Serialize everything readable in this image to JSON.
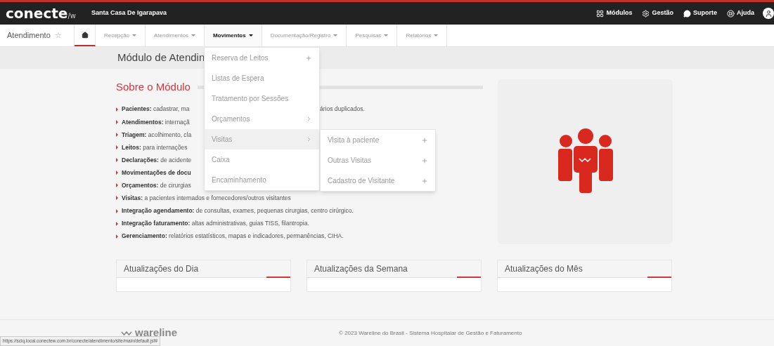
{
  "topbar": {
    "logo": "conecte",
    "logo_suffix": "/w",
    "site": "Santa Casa De Igarapava",
    "links": [
      {
        "kind": "grid",
        "label": "Módulos"
      },
      {
        "kind": "gear",
        "label": "Gestão"
      },
      {
        "kind": "chat",
        "label": "Suporte"
      },
      {
        "kind": "help",
        "label": "Ajuda"
      }
    ]
  },
  "nav": {
    "module": "Atendimento",
    "star": "☆",
    "tabs": [
      {
        "kind": "home",
        "selected": true
      },
      {
        "kind": "menu",
        "label": "Recepção",
        "selected": false,
        "open": false
      },
      {
        "kind": "menu",
        "label": "Atendimentos",
        "selected": false,
        "open": false
      },
      {
        "kind": "menu",
        "label": "Movimentos",
        "selected": false,
        "open": true
      },
      {
        "kind": "menu",
        "label": "Documentação/Registro",
        "selected": false,
        "open": false
      },
      {
        "kind": "menu",
        "label": "Pesquisas",
        "selected": false,
        "open": false
      },
      {
        "kind": "menu",
        "label": "Relatórios",
        "selected": false,
        "open": false
      }
    ]
  },
  "page_title": "Módulo de Atendin",
  "about": {
    "title": "Sobre o Módulo",
    "items": [
      {
        "label": "Pacientes:",
        "text": " cadastrar, ma",
        "tail": "ários duplicados."
      },
      {
        "label": "Atendimentos:",
        "text": " internaçã"
      },
      {
        "label": "Triagem:",
        "text": " acolhimento, cla"
      },
      {
        "label": "Leitos:",
        "text": " para internações "
      },
      {
        "label": "Declarações:",
        "text": " de acidente"
      },
      {
        "label": "Movimentações de docu"
      },
      {
        "label": "Orçamentos:",
        "text": " de cirurgias"
      },
      {
        "label": "Visitas:",
        "text": " a pacientes internados e fornecedores/outros visitantes"
      },
      {
        "label": "Integração agendamento:",
        "text": " de consultas, exames, pequenas cirurgias, centro cirúrgico."
      },
      {
        "label": "Integração faturamento:",
        "text": " altas administrativas, guias TISS, filantropia."
      },
      {
        "label": "Gerenciamento:",
        "text": " relatórios estatísticos, mapas e indicadores, permanências, CIHA."
      }
    ]
  },
  "updates": [
    {
      "title": "Atualizações do Dia"
    },
    {
      "title": "Atualizações da Semana"
    },
    {
      "title": "Atualizações do Mês"
    }
  ],
  "menu": [
    {
      "kind": "plus",
      "label": "Reserva de Leitos",
      "selected": false
    },
    {
      "kind": "plain",
      "label": "Listas de Espera",
      "selected": false
    },
    {
      "kind": "plain",
      "label": "Tratamento por Sessões",
      "selected": false
    },
    {
      "kind": "submenu",
      "label": "Orçamentos",
      "selected": false
    },
    {
      "kind": "submenu",
      "label": "Visitas",
      "selected": true
    },
    {
      "kind": "plain",
      "label": "Caixa",
      "selected": false
    },
    {
      "kind": "plain",
      "label": "Encaminhamento",
      "selected": false
    }
  ],
  "submenu": [
    {
      "kind": "plus",
      "label": "Visita à paciente",
      "selected": false
    },
    {
      "kind": "plus",
      "label": "Outras Visitas",
      "selected": false
    },
    {
      "kind": "plus",
      "label": "Cadastro de Visitante",
      "selected": false
    }
  ],
  "footer": {
    "logo": "wareline",
    "copyright": "© 2023 Wareline do Brasil - Sistema Hospitalar de Gestão e Faturamento"
  },
  "status_url": "https://sciq.local.conectew.com.br/conecte/atendimento/site/main/default.jsf#"
}
